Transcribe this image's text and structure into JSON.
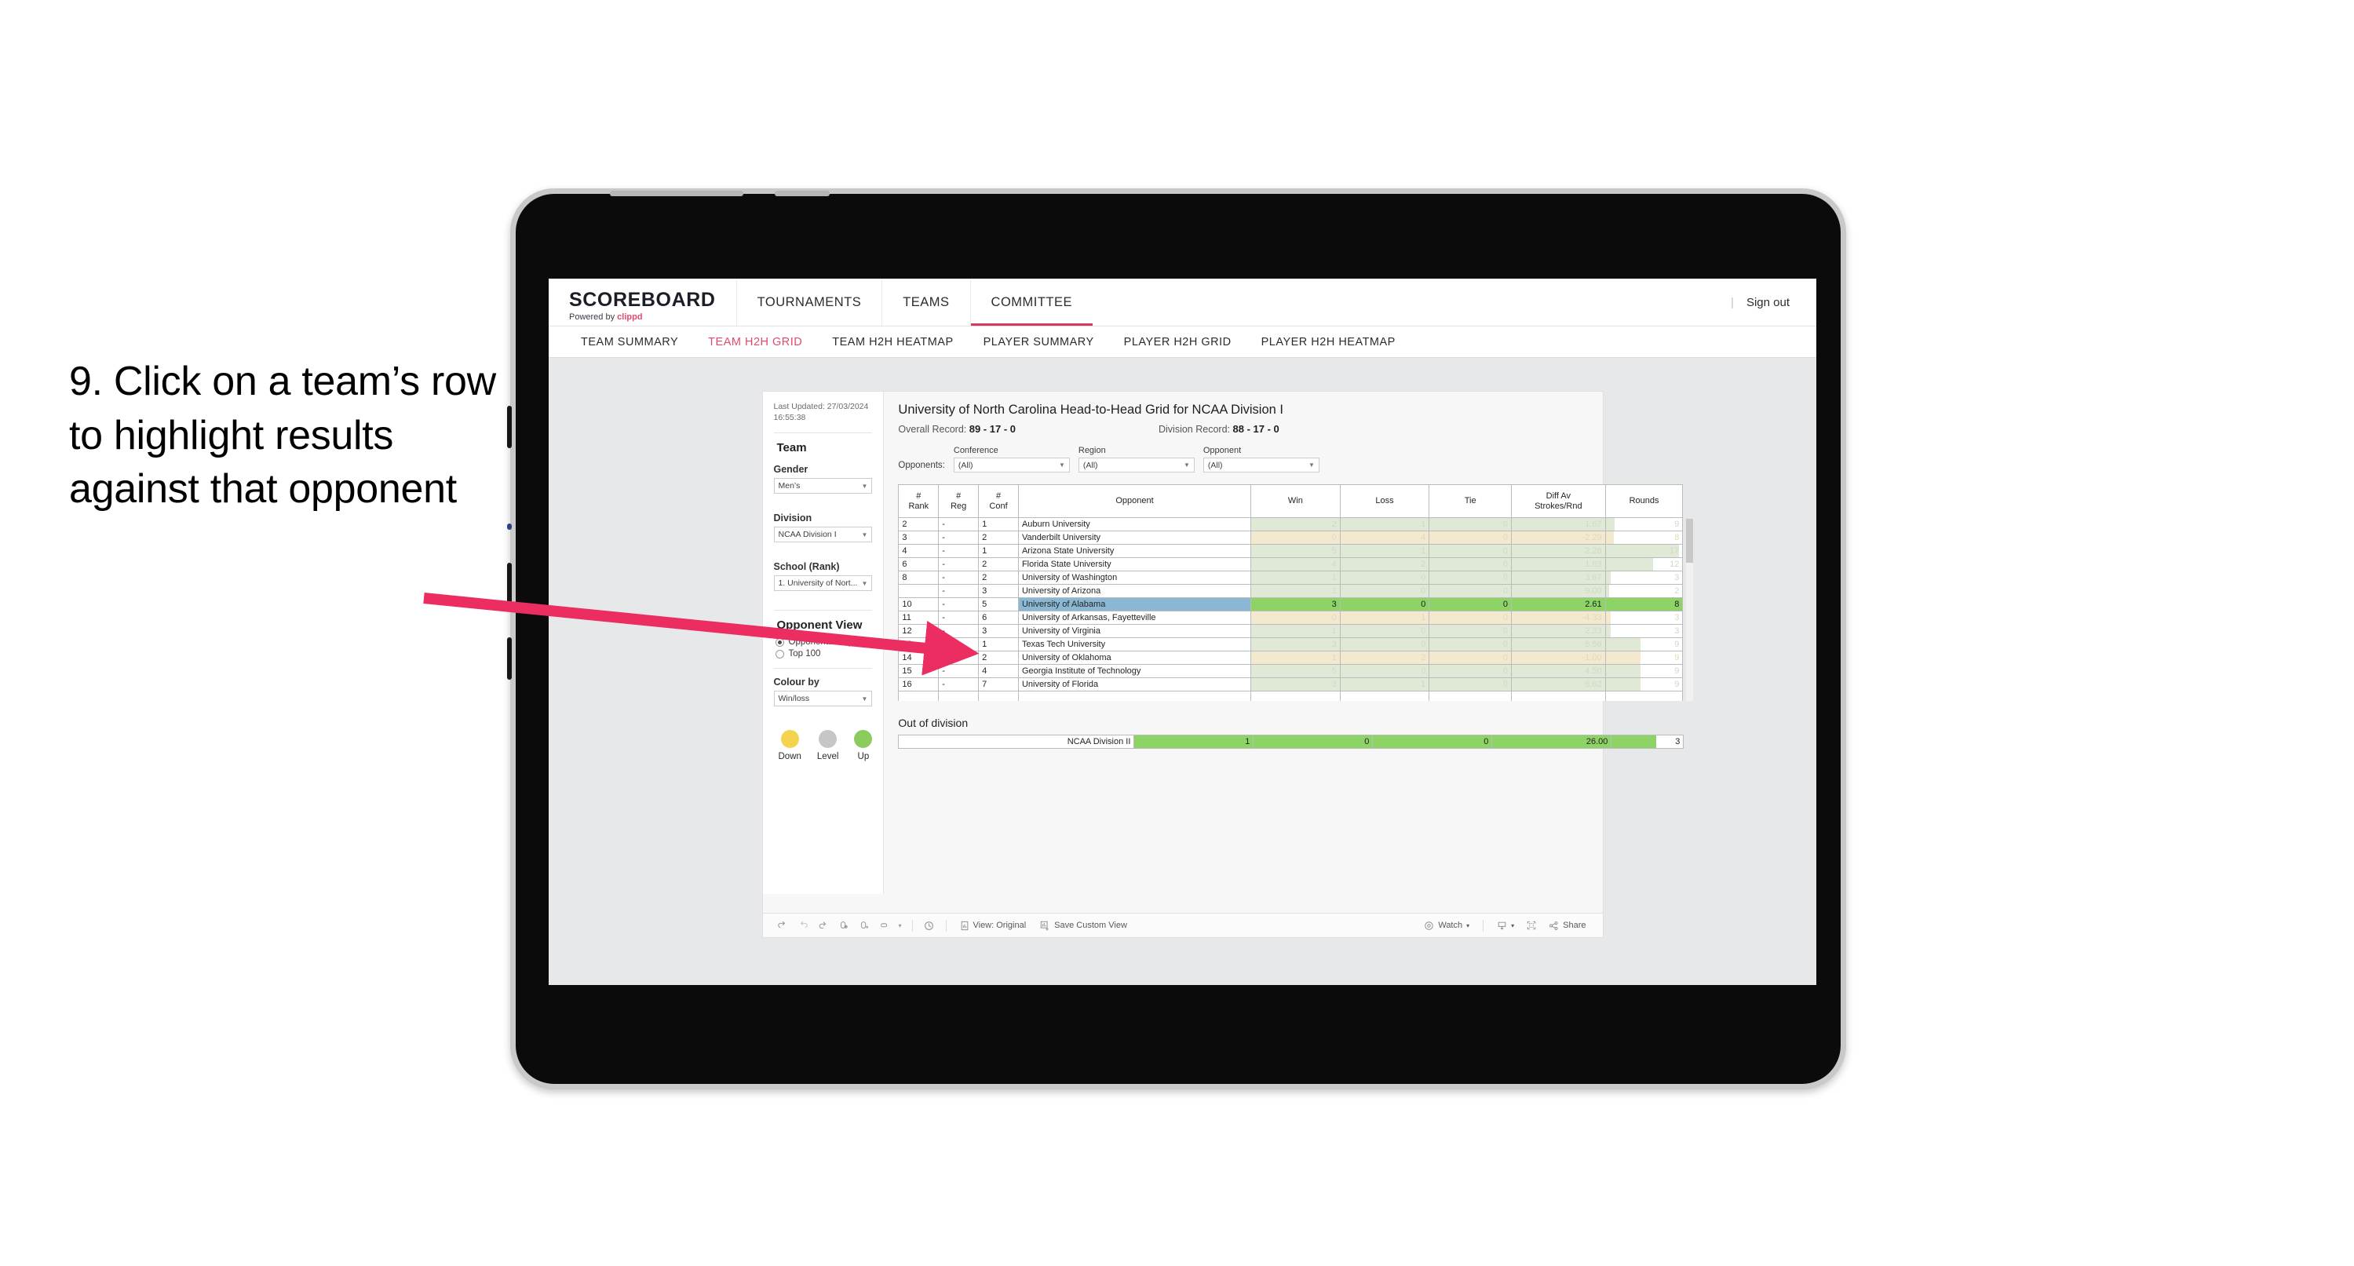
{
  "annotation": {
    "step_text": "9. Click on a team’s row to highlight results against that opponent",
    "arrow_color": "#ec2d62"
  },
  "appbar": {
    "brand_title": "SCOREBOARD",
    "brand_powered": "Powered by",
    "brand_name": "clippd",
    "tabs": [
      {
        "label": "TOURNAMENTS",
        "active": false
      },
      {
        "label": "TEAMS",
        "active": false
      },
      {
        "label": "COMMITTEE",
        "active": true
      }
    ],
    "separator": "|",
    "sign_out": "Sign out",
    "accent": "#d7395f"
  },
  "subnav": {
    "tabs": [
      {
        "label": "TEAM SUMMARY",
        "active": false
      },
      {
        "label": "TEAM H2H GRID",
        "active": true
      },
      {
        "label": "TEAM H2H HEATMAP",
        "active": false
      },
      {
        "label": "PLAYER SUMMARY",
        "active": false
      },
      {
        "label": "PLAYER H2H GRID",
        "active": false
      },
      {
        "label": "PLAYER H2H HEATMAP",
        "active": false
      }
    ]
  },
  "sidebar": {
    "last_updated": "Last Updated: 27/03/2024 16:55:38",
    "team_heading": "Team",
    "gender_label": "Gender",
    "gender_value": "Men’s",
    "division_label": "Division",
    "division_value": "NCAA Division I",
    "school_label": "School (Rank)",
    "school_value": "1. University of Nort...",
    "opponent_view_heading": "Opponent View",
    "opponent_view_options": [
      {
        "label": "Opponents Played",
        "selected": true
      },
      {
        "label": "Top 100",
        "selected": false
      }
    ],
    "colour_by_label": "Colour by",
    "colour_by_value": "Win/loss",
    "legend": [
      {
        "label": "Down",
        "color": "#f4d44e"
      },
      {
        "label": "Level",
        "color": "#c6c6c6"
      },
      {
        "label": "Up",
        "color": "#8ccc5e"
      }
    ]
  },
  "main": {
    "title": "University of North Carolina Head-to-Head Grid for NCAA Division I",
    "overall_record_label": "Overall Record:",
    "overall_record_value": "89 - 17 - 0",
    "division_record_label": "Division Record:",
    "division_record_value": "88 - 17 - 0",
    "opponents_label": "Opponents:",
    "filters": [
      {
        "label": "Conference",
        "value": "(All)"
      },
      {
        "label": "Region",
        "value": "(All)"
      },
      {
        "label": "Opponent",
        "value": "(All)"
      }
    ],
    "out_of_division_heading": "Out of division"
  },
  "chart_data": {
    "type": "table",
    "title": "University of North Carolina Head-to-Head Grid for NCAA Division I",
    "columns": [
      "# Rank",
      "# Reg",
      "# Conf",
      "Opponent",
      "Win",
      "Loss",
      "Tie",
      "Diff Av Strokes/Rnd",
      "Rounds"
    ],
    "column_header_lines": [
      [
        "#",
        "Rank"
      ],
      [
        "#",
        "Reg"
      ],
      [
        "#",
        "Conf"
      ],
      [
        "Opponent"
      ],
      [
        "Win"
      ],
      [
        "Loss"
      ],
      [
        "Tie"
      ],
      [
        "Diff Av",
        "Strokes/Rnd"
      ],
      [
        "Rounds"
      ]
    ],
    "selected_row_index": 6,
    "rows": [
      {
        "rank": "2",
        "reg": "-",
        "conf": "1",
        "opponent": "Auburn University",
        "win": "2",
        "loss": "1",
        "tie": "0",
        "diff": "1.67",
        "rounds": "9",
        "tone": "up",
        "winw": 0.29,
        "lossw": 0.29,
        "tiew": 0.29,
        "diffw": 0.4,
        "rndw": 0.12
      },
      {
        "rank": "3",
        "reg": "-",
        "conf": "2",
        "opponent": "Vanderbilt University",
        "win": "0",
        "loss": "4",
        "tie": "0",
        "diff": "-2.29",
        "rounds": "8",
        "tone": "down",
        "winw": 0.29,
        "lossw": 0.29,
        "tiew": 0.29,
        "diffw": 0.4,
        "rndw": 0.11
      },
      {
        "rank": "4",
        "reg": "-",
        "conf": "1",
        "opponent": "Arizona State University",
        "win": "5",
        "loss": "1",
        "tie": "0",
        "diff": "2.28",
        "rounds": "17",
        "tone": "up",
        "winw": 0.29,
        "lossw": 0.29,
        "tiew": 0.29,
        "diffw": 0.4,
        "rndw": 0.96
      },
      {
        "rank": "6",
        "reg": "-",
        "conf": "2",
        "opponent": "Florida State University",
        "win": "4",
        "loss": "2",
        "tie": "0",
        "diff": "1.83",
        "rounds": "12",
        "tone": "up",
        "winw": 0.29,
        "lossw": 0.29,
        "tiew": 0.29,
        "diffw": 0.4,
        "rndw": 0.62
      },
      {
        "rank": "8",
        "reg": "-",
        "conf": "2",
        "opponent": "University of Washington",
        "win": "1",
        "loss": "0",
        "tie": "0",
        "diff": "3.67",
        "rounds": "3",
        "tone": "up",
        "winw": 0.29,
        "lossw": 0.29,
        "tiew": 0.29,
        "diffw": 0.4,
        "rndw": 0.06
      },
      {
        "rank": "",
        "reg": "-",
        "conf": "3",
        "opponent": "University of Arizona",
        "win": "1",
        "loss": "0",
        "tie": "0",
        "diff": "9.00",
        "rounds": "2",
        "tone": "up",
        "winw": 0.29,
        "lossw": 0.29,
        "tiew": 0.29,
        "diffw": 0.4,
        "rndw": 0.04
      },
      {
        "rank": "10",
        "reg": "-",
        "conf": "5",
        "opponent": "University of Alabama",
        "win": "3",
        "loss": "0",
        "tie": "0",
        "diff": "2.61",
        "rounds": "8",
        "tone": "selected",
        "winw": 1,
        "lossw": 1,
        "tiew": 1,
        "diffw": 1,
        "rndw": 0.1
      },
      {
        "rank": "11",
        "reg": "-",
        "conf": "6",
        "opponent": "University of Arkansas, Fayetteville",
        "win": "0",
        "loss": "1",
        "tie": "0",
        "diff": "-4.33",
        "rounds": "3",
        "tone": "down",
        "winw": 0.29,
        "lossw": 0.29,
        "tiew": 0.29,
        "diffw": 0.4,
        "rndw": 0.06
      },
      {
        "rank": "12",
        "reg": "-",
        "conf": "3",
        "opponent": "University of Virginia",
        "win": "1",
        "loss": "0",
        "tie": "0",
        "diff": "2.33",
        "rounds": "3",
        "tone": "up",
        "winw": 0.29,
        "lossw": 0.29,
        "tiew": 0.29,
        "diffw": 0.4,
        "rndw": 0.06
      },
      {
        "rank": "13",
        "reg": "-",
        "conf": "1",
        "opponent": "Texas Tech University",
        "win": "3",
        "loss": "0",
        "tie": "0",
        "diff": "5.56",
        "rounds": "9",
        "tone": "up",
        "winw": 0.29,
        "lossw": 0.29,
        "tiew": 0.29,
        "diffw": 0.4,
        "rndw": 0.45
      },
      {
        "rank": "14",
        "reg": "-",
        "conf": "2",
        "opponent": "University of Oklahoma",
        "win": "1",
        "loss": "2",
        "tie": "0",
        "diff": "-1.00",
        "rounds": "9",
        "tone": "down",
        "winw": 0.29,
        "lossw": 0.29,
        "tiew": 0.29,
        "diffw": 0.4,
        "rndw": 0.45
      },
      {
        "rank": "15",
        "reg": "-",
        "conf": "4",
        "opponent": "Georgia Institute of Technology",
        "win": "5",
        "loss": "0",
        "tie": "0",
        "diff": "4.50",
        "rounds": "9",
        "tone": "up",
        "winw": 0.29,
        "lossw": 0.29,
        "tiew": 0.29,
        "diffw": 0.4,
        "rndw": 0.45
      },
      {
        "rank": "16",
        "reg": "-",
        "conf": "7",
        "opponent": "University of Florida",
        "win": "3",
        "loss": "1",
        "tie": "0",
        "diff": "6.62",
        "rounds": "9",
        "tone": "up",
        "winw": 0.29,
        "lossw": 0.29,
        "tiew": 0.29,
        "diffw": 0.4,
        "rndw": 0.45
      }
    ],
    "out_of_division": [
      {
        "opponent": "NCAA Division II",
        "win": "1",
        "loss": "0",
        "tie": "0",
        "diff": "26.00",
        "rounds": "3",
        "tone": "selected"
      }
    ]
  },
  "toolbar": {
    "icons": [
      "undo-icon",
      "redo-icon",
      "revert-icon",
      "refresh-data-icon",
      "pause-icon",
      "highlight-icon",
      "dropdown-caret-icon",
      "clock-history-icon"
    ],
    "view_label": "View: Original",
    "save_label": "Save Custom View",
    "watch_label": "Watch",
    "share_label": "Share"
  }
}
